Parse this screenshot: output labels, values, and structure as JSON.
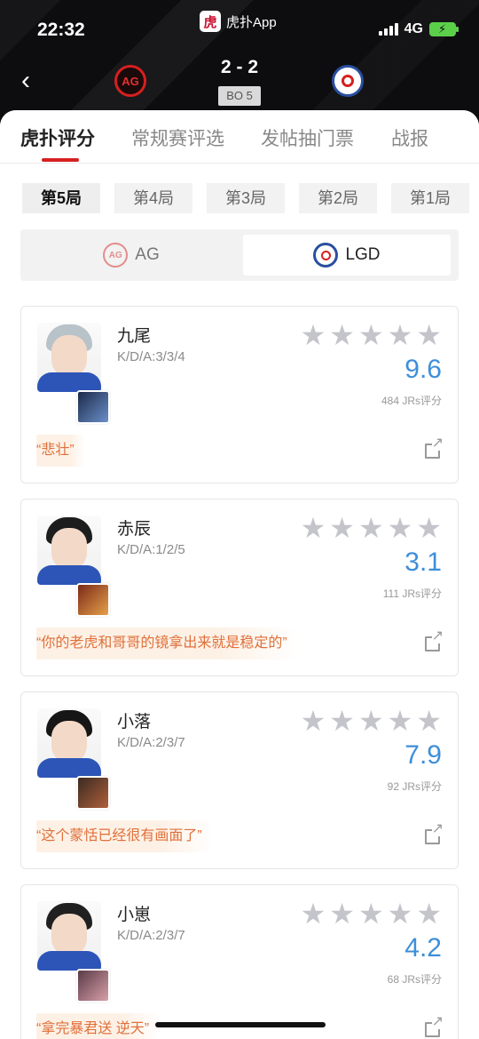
{
  "status_bar": {
    "time": "22:32",
    "app_name": "虎扑App",
    "app_logo_char": "虎",
    "network": "4G"
  },
  "match": {
    "score": "2 - 2",
    "format": "BO 5",
    "home_team_logo_text": "AG"
  },
  "tabs": [
    {
      "label": "虎扑评分",
      "active": true
    },
    {
      "label": "常规赛评选",
      "active": false
    },
    {
      "label": "发帖抽门票",
      "active": false
    },
    {
      "label": "战报",
      "active": false
    }
  ],
  "games": [
    {
      "label": "第5局",
      "active": true
    },
    {
      "label": "第4局",
      "active": false
    },
    {
      "label": "第3局",
      "active": false
    },
    {
      "label": "第2局",
      "active": false
    },
    {
      "label": "第1局",
      "active": false
    }
  ],
  "teams": [
    {
      "name": "AG",
      "logo_text": "AG",
      "selected": false
    },
    {
      "name": "LGD",
      "selected": true
    }
  ],
  "players": [
    {
      "name": "九尾",
      "kda": "K/D/A:3/3/4",
      "rating": "9.6",
      "count": "484 JRs评分",
      "comment": "“悲壮”",
      "hair": "#b7c2c9",
      "hero_colors": [
        "#1c2a4a",
        "#6a8fc9"
      ]
    },
    {
      "name": "赤辰",
      "kda": "K/D/A:1/2/5",
      "rating": "3.1",
      "count": "111 JRs评分",
      "comment": "“你的老虎和哥哥的镜拿出来就是稳定的”",
      "hair": "#1d1d1d",
      "hero_colors": [
        "#7a2a18",
        "#e6a04a"
      ]
    },
    {
      "name": "小落",
      "kda": "K/D/A:2/3/7",
      "rating": "7.9",
      "count": "92 JRs评分",
      "comment": "“这个蒙恬已经很有画面了”",
      "hair": "#161616",
      "hero_colors": [
        "#3a2a22",
        "#b0603a"
      ]
    },
    {
      "name": "小崽",
      "kda": "K/D/A:2/3/7",
      "rating": "4.2",
      "count": "68 JRs评分",
      "comment": "“拿完暴君送 逆天”",
      "hair": "#202020",
      "hero_colors": [
        "#5a3a48",
        "#d8a0a8"
      ]
    }
  ],
  "colors": {
    "brand_red": "#d62020",
    "rating_blue": "#3d8fd9",
    "comment_orange": "#e0703a"
  },
  "icons": {
    "back": "chevron-left-icon",
    "share": "share-icon",
    "star": "star-icon"
  }
}
